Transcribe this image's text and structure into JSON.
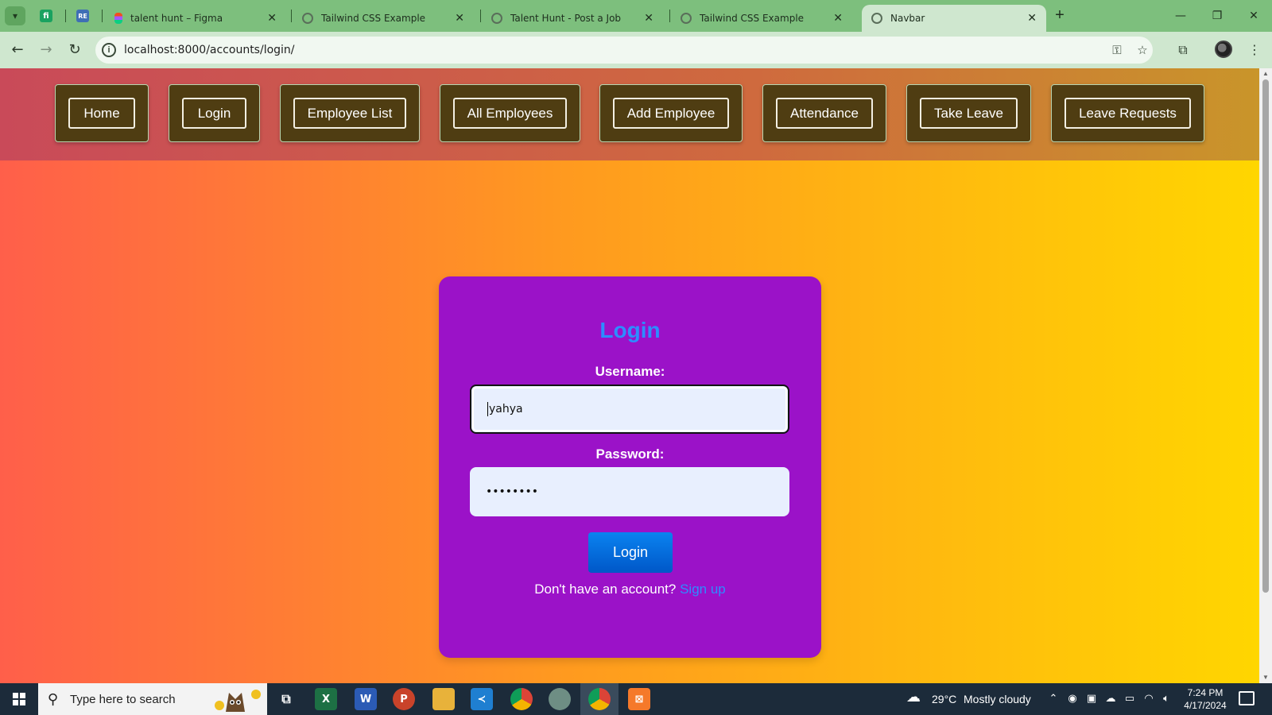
{
  "browser": {
    "tabs": [
      {
        "title": "talent hunt – Figma",
        "favicon": "figma-icon",
        "active": false
      },
      {
        "title": "Tailwind CSS Example",
        "favicon": "globe-icon",
        "active": false
      },
      {
        "title": "Talent Hunt - Post a Job",
        "favicon": "globe-icon",
        "active": false
      },
      {
        "title": "Tailwind CSS Example",
        "favicon": "globe-icon",
        "active": false
      },
      {
        "title": "Navbar",
        "favicon": "globe-icon",
        "active": true
      }
    ],
    "url": "localhost:8000/accounts/login/",
    "accent": "#7dbf7d"
  },
  "navbar": {
    "items": [
      "Home",
      "Login",
      "Employee List",
      "All Employees",
      "Add Employee",
      "Attendance",
      "Take Leave",
      "Leave Requests"
    ]
  },
  "login": {
    "title": "Login",
    "username_label": "Username:",
    "username_value": "yahya",
    "password_label": "Password:",
    "password_value": "••••••••",
    "submit_label": "Login",
    "signup_prompt": "Don't have an account?",
    "signup_link": "Sign up",
    "card_color": "#9b12c8",
    "title_color": "#2d8cff"
  },
  "taskbar": {
    "search_placeholder": "Type here to search",
    "weather_temp": "29°C",
    "weather_text": "Mostly cloudy",
    "time": "7:24 PM",
    "date": "4/17/2024"
  }
}
